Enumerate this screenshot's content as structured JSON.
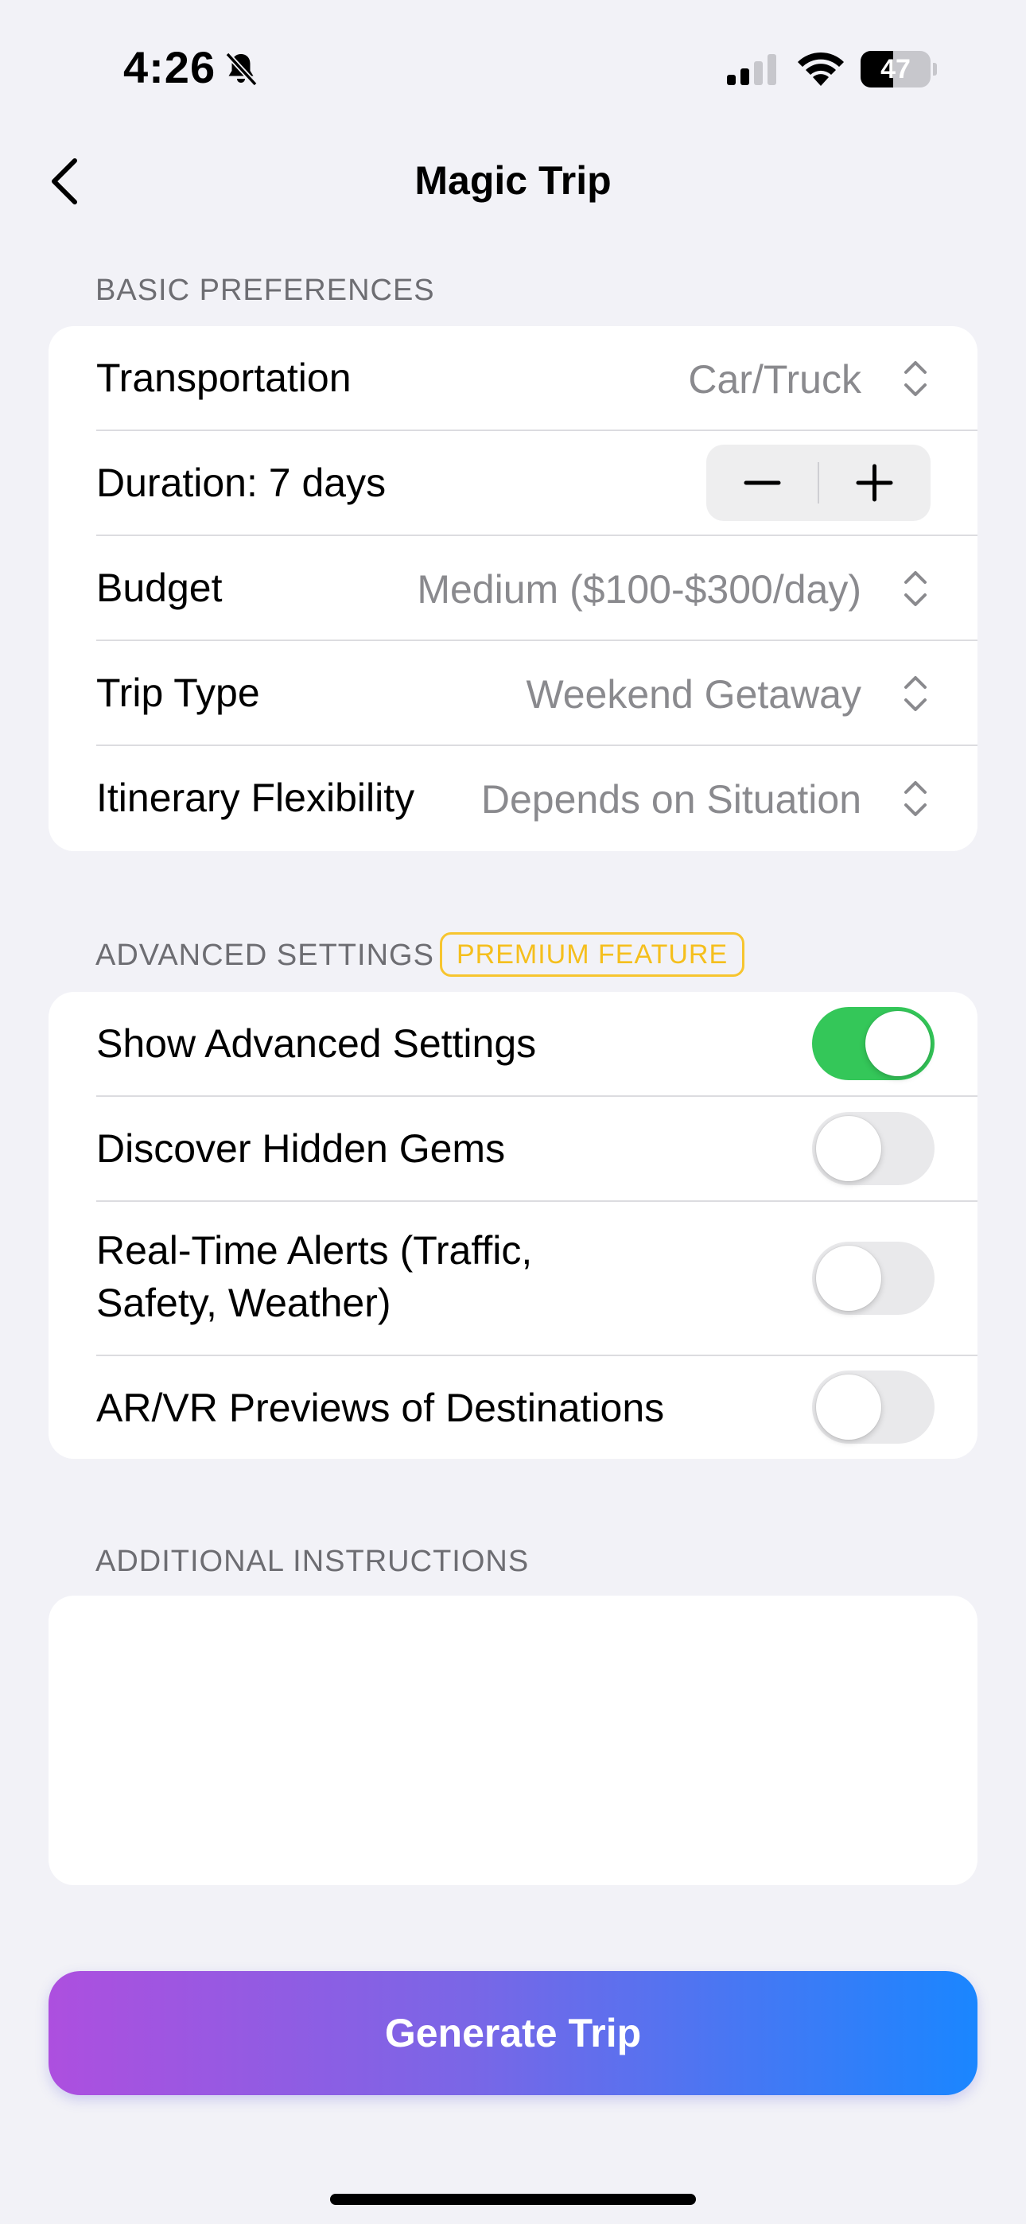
{
  "status_bar": {
    "time": "4:26",
    "battery_level": "47",
    "battery_fraction": 0.47,
    "icons": [
      "bell-slash-icon",
      "cellular-signal-icon",
      "wifi-icon",
      "battery-icon"
    ]
  },
  "nav": {
    "title": "Magic Trip",
    "back_icon": "chevron-left-icon"
  },
  "basic": {
    "header": "BASIC PREFERENCES",
    "transportation": {
      "label": "Transportation",
      "value": "Car/Truck"
    },
    "duration": {
      "label": "Duration: 7 days",
      "minus": "−",
      "plus": "+"
    },
    "budget": {
      "label": "Budget",
      "value": "Medium ($100-$300/day)"
    },
    "trip_type": {
      "label": "Trip Type",
      "value": "Weekend Getaway"
    },
    "flexibility": {
      "label": "Itinerary Flexibility",
      "value": "Depends on Situation"
    }
  },
  "advanced": {
    "header": "ADVANCED SETTINGS",
    "badge": "PREMIUM FEATURE",
    "toggles": [
      {
        "label": "Show Advanced Settings",
        "on": true
      },
      {
        "label": "Discover Hidden Gems",
        "on": false
      },
      {
        "label_line1": "Real-Time Alerts (Traffic,",
        "label_line2": "Safety, Weather)",
        "on": false
      },
      {
        "label": "AR/VR Previews of Destinations",
        "on": false
      }
    ]
  },
  "additional": {
    "header": "ADDITIONAL INSTRUCTIONS",
    "value": "",
    "placeholder": ""
  },
  "generate": {
    "label": "Generate Trip"
  },
  "colors": {
    "background": "#f2f2f7",
    "toggle_on": "#34c759",
    "toggle_off": "#e9e9eb",
    "premium": "#f5bf1d",
    "gradient_start": "#ad4fdf",
    "gradient_end": "#1a86ff",
    "secondary_text": "#8a8a8e"
  }
}
